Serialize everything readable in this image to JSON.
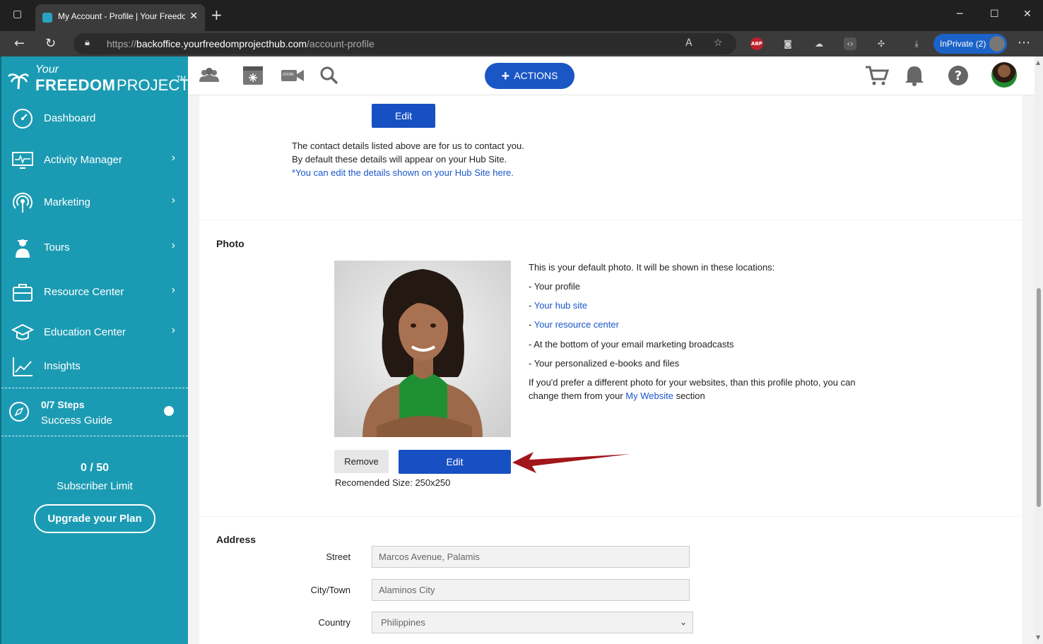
{
  "browser": {
    "tab_title": "My Account - Profile | Your Freedom",
    "url_prefix": "https://",
    "url_host": "backoffice.yourfreedomprojecthub.com",
    "url_path": "/account-profile",
    "inprivate_label": "InPrivate (2)",
    "abp_label": "ABP"
  },
  "logo": {
    "your": "Your",
    "freedom": "FREEDOM",
    "project": "PROJECT",
    "tm": "TM"
  },
  "sidebar": {
    "items": [
      {
        "label": "Dashboard",
        "icon": "dashboard-icon",
        "chevron": ""
      },
      {
        "label": "Activity Manager",
        "icon": "monitor-icon",
        "chevron": "›"
      },
      {
        "label": "Marketing",
        "icon": "broadcast-icon",
        "chevron": "›"
      },
      {
        "label": "Tours",
        "icon": "tour-guide-icon",
        "chevron": "›"
      },
      {
        "label": "Resource Center",
        "icon": "briefcase-icon",
        "chevron": "›"
      },
      {
        "label": "Education Center",
        "icon": "graduation-cap-icon",
        "chevron": "›"
      },
      {
        "label": "Insights",
        "icon": "chart-icon",
        "chevron": ""
      }
    ],
    "guide_steps": "0/7  Steps",
    "guide_label": "Success Guide",
    "subscriber_count": "0 / 50",
    "subscriber_label": "Subscriber Limit",
    "upgrade_label": "Upgrade your Plan"
  },
  "header": {
    "actions_label": "ACTIONS",
    "actions_plus": "+",
    "zoom_label": "ZOOM"
  },
  "contact": {
    "edit_label": "Edit",
    "line1": "The contact details listed above are for us to contact you.",
    "line2": "By default these details will appear on your Hub Site.",
    "link": "*You can edit the details shown on your Hub Site here."
  },
  "photo_section": {
    "title": "Photo",
    "intro": "This is your default photo. It will be shown in these locations:",
    "loc1": "- Your profile",
    "loc2_prefix": "- ",
    "loc2_link": "Your hub site",
    "loc3_prefix": "- ",
    "loc3_link": "Your resource center",
    "loc4": "- At the bottom of your email marketing broadcasts",
    "loc5": "- Your personalized e-books and files",
    "pref1": "If you'd prefer a different photo for your websites, than this profile photo, you can",
    "pref2_a": "change them from your ",
    "pref2_link": "My Website",
    "pref2_b": " section",
    "remove_label": "Remove",
    "edit_label": "Edit",
    "recommended": "Recomended Size: 250x250",
    "arrow_color": "#a0161b"
  },
  "address": {
    "title": "Address",
    "street_label": "Street",
    "street_value": "Marcos Avenue, Palamis",
    "city_label": "City/Town",
    "city_value": "Alaminos City",
    "country_label": "Country",
    "country_value": "Philippines"
  },
  "colors": {
    "sidebar": "#1b9bb3",
    "primary_button": "#1750c2",
    "link": "#1a57c9"
  }
}
